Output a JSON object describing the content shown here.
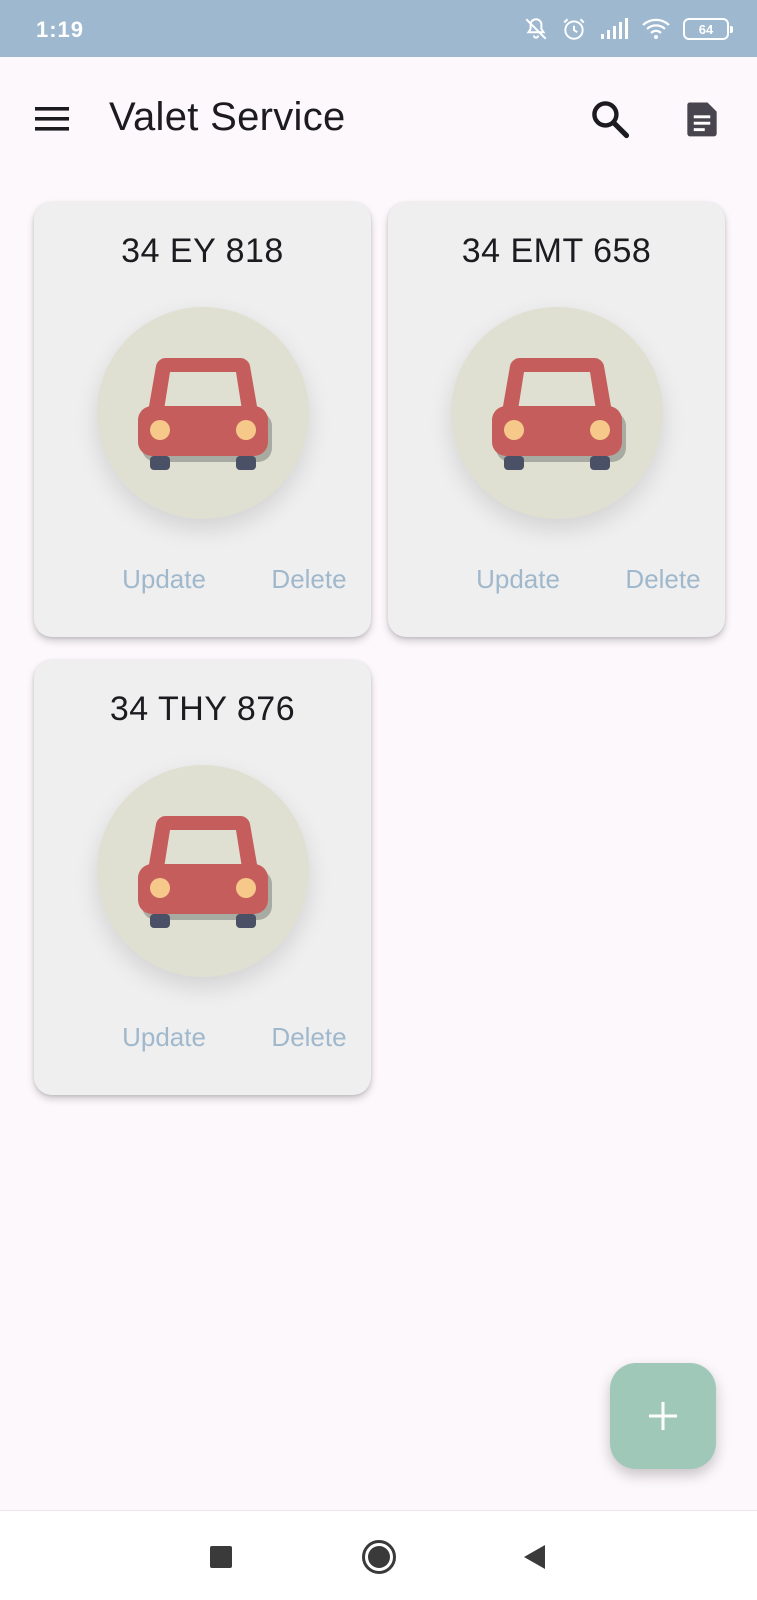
{
  "status_bar": {
    "time": "1:19",
    "battery_level": "64",
    "icons": [
      "bell-off-icon",
      "alarm-icon",
      "signal-icon",
      "wifi-icon",
      "battery-icon"
    ]
  },
  "app_bar": {
    "title": "Valet Service",
    "icons": [
      "menu-icon",
      "search-icon",
      "report-icon"
    ]
  },
  "cars": [
    {
      "plate": "34 EY 818",
      "update_label": "Update",
      "delete_label": "Delete"
    },
    {
      "plate": "34 EMT 658",
      "update_label": "Update",
      "delete_label": "Delete"
    },
    {
      "plate": "34 THY 876",
      "update_label": "Update",
      "delete_label": "Delete"
    }
  ],
  "fab": {
    "icon": "plus-icon"
  },
  "nav_bar": {
    "icons": [
      "recents-icon",
      "home-icon",
      "back-icon"
    ]
  },
  "colors": {
    "status_bar": "#9db8cf",
    "background": "#fdf8fc",
    "card": "#efeff0",
    "avatar": "#dfe0d2",
    "car_body": "#c65d5d",
    "headlight": "#f6c98a",
    "card_button_text": "#a0b8cc",
    "fab": "#9fc8b9"
  }
}
